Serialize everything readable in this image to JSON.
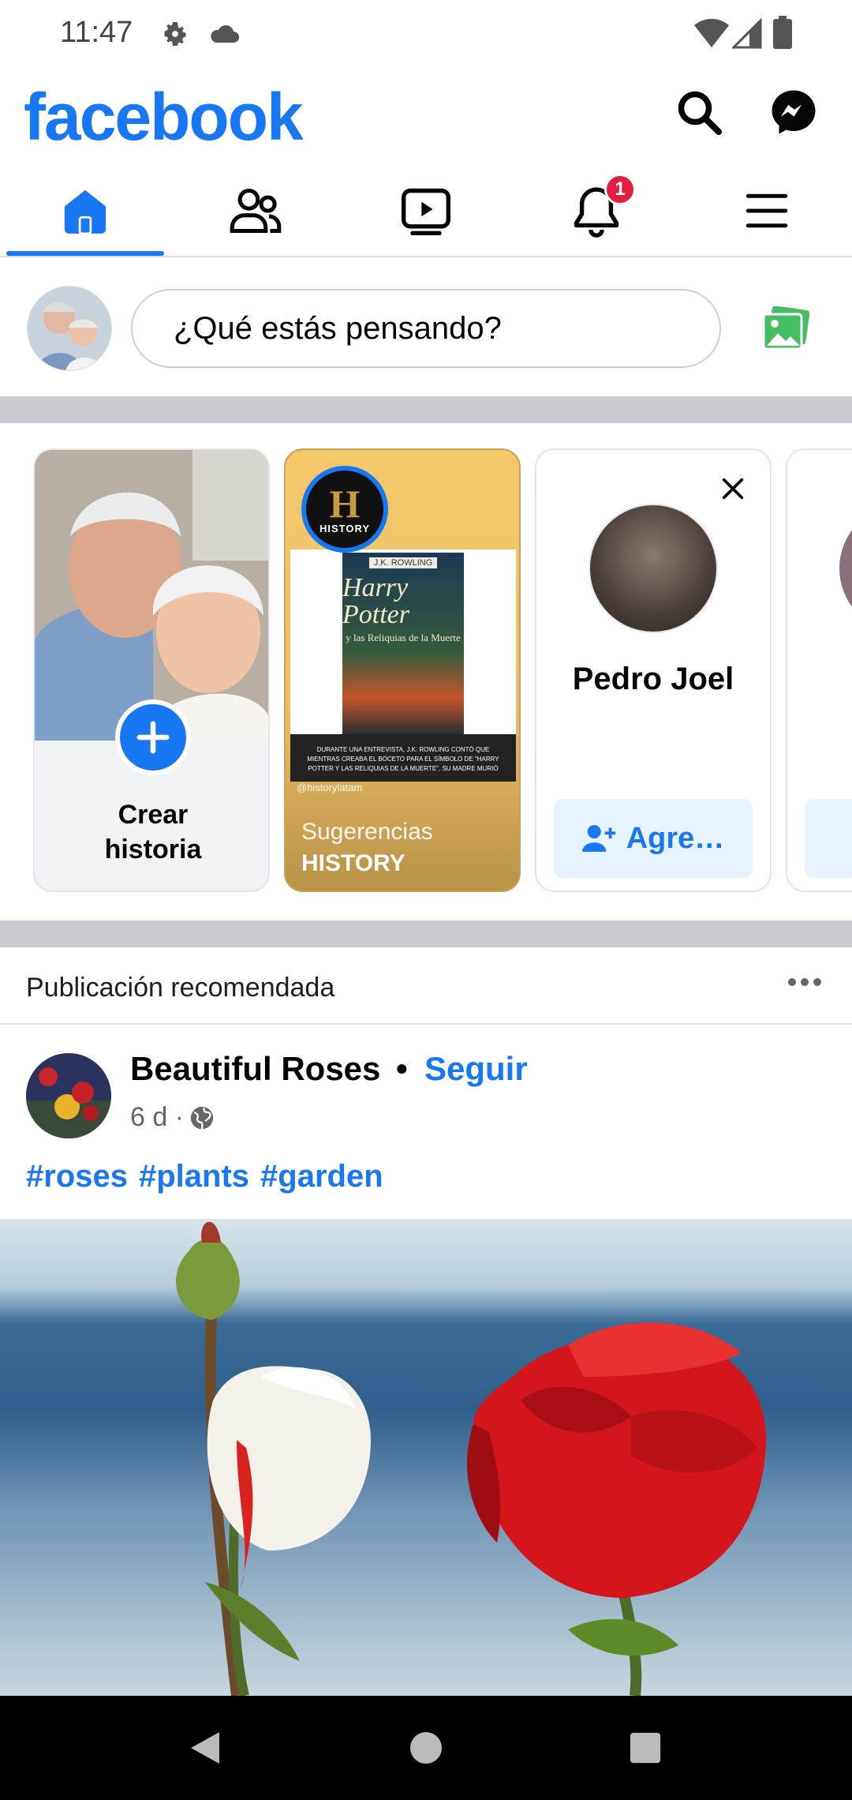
{
  "status_bar": {
    "time": "11:47",
    "icons": [
      "gear-icon",
      "cloud-icon",
      "wifi-icon",
      "signal-icon",
      "battery-icon"
    ]
  },
  "header": {
    "logo": "facebook",
    "brand_color": "#1877f2",
    "actions": [
      "search-icon",
      "messenger-icon"
    ]
  },
  "tabs": {
    "items": [
      "home-icon",
      "friends-icon",
      "watch-icon",
      "notifications-icon",
      "menu-icon"
    ],
    "active": "home-icon",
    "notification_count": "1"
  },
  "composer": {
    "placeholder": "¿Qué estás pensando?",
    "photo_icon": "photo-icon"
  },
  "stories": {
    "create": {
      "label": "Crear historia"
    },
    "history": {
      "logo_letter": "H",
      "logo_word": "HISTORY",
      "book_author": "J.K. ROWLING",
      "book_title": "Harry Potter",
      "book_subtitle": "y las Reliquias de la Muerte",
      "caption": "DURANTE UNA ENTREVISTA, J.K. ROWLING CONTÓ QUE MIENTRAS CREABA EL BOCETO PARA EL SÍMBOLO DE \"HARRY POTTER Y LAS RELIQUIAS DE LA MUERTE\", SU MADRE MURIÓ",
      "handle": "@historylatam",
      "label_top": "Sugerencias",
      "label_bottom": "HISTORY"
    },
    "person": {
      "name": "Pedro Joel",
      "button_label": "Agre…"
    }
  },
  "feed": {
    "section_label": "Publicación recomendada",
    "post": {
      "page_name": "Beautiful Roses",
      "separator": "•",
      "follow_label": "Seguir",
      "time": "6 d ·",
      "privacy_icon": "globe-icon",
      "hashtags": [
        "#roses",
        "#plants",
        "#garden"
      ]
    }
  },
  "nav_bar": {
    "buttons": [
      "back-icon",
      "home-circle-icon",
      "recents-icon"
    ]
  }
}
